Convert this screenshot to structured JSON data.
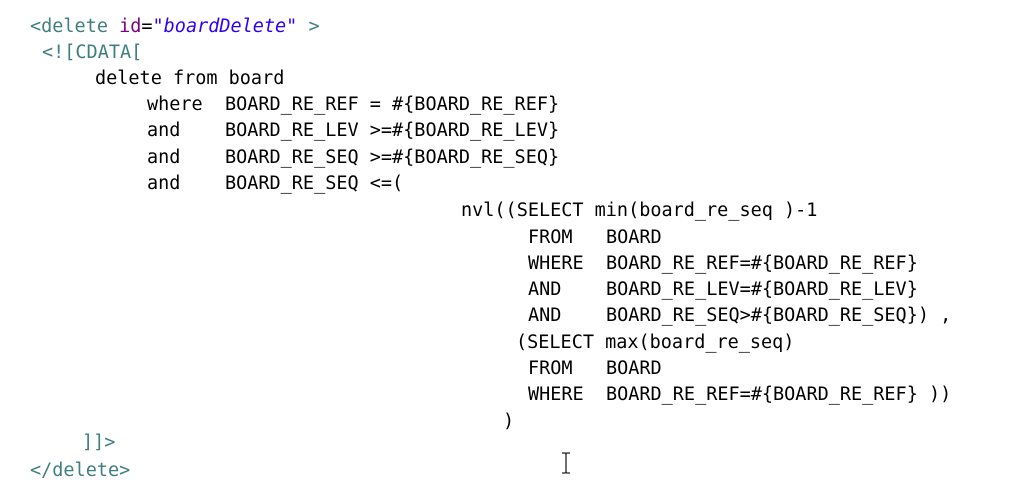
{
  "editor": {
    "colors": {
      "tag": "#3f7f7f",
      "attribute": "#7f007f",
      "string": "#2a00ff",
      "text": "#000000",
      "background": "#ffffff"
    },
    "lines": [
      {
        "indent": 0,
        "tokens": [
          {
            "t": "tag",
            "v": "<delete "
          },
          {
            "t": "attr",
            "v": "id"
          },
          {
            "t": "punct",
            "v": "="
          },
          {
            "t": "str",
            "v": "\"boardDelete\""
          },
          {
            "t": "tag",
            "v": " >"
          }
        ]
      },
      {
        "indent": 1,
        "tokens": [
          {
            "t": "cdata",
            "v": "<![CDATA["
          }
        ]
      },
      {
        "indent": 2,
        "tokens": [
          {
            "t": "kw",
            "v": "delete from board"
          }
        ]
      },
      {
        "indent": 3,
        "tokens": [
          {
            "t": "kw",
            "v": "where  BOARD_RE_REF = #{BOARD_RE_REF}"
          }
        ]
      },
      {
        "indent": 3,
        "tokens": [
          {
            "t": "kw",
            "v": "and    BOARD_RE_LEV >=#{BOARD_RE_LEV}"
          }
        ]
      },
      {
        "indent": 3,
        "tokens": [
          {
            "t": "kw",
            "v": "and    BOARD_RE_SEQ >=#{BOARD_RE_SEQ}"
          }
        ]
      },
      {
        "indent": 3,
        "tokens": [
          {
            "t": "kw",
            "v": "and    BOARD_RE_SEQ <=("
          }
        ]
      },
      {
        "indent": 4,
        "tokens": [
          {
            "t": "kw",
            "v": "nvl((SELECT min(board_re_seq )-1"
          }
        ]
      },
      {
        "indent": 5,
        "tokens": [
          {
            "t": "kw",
            "v": "FROM   BOARD"
          }
        ]
      },
      {
        "indent": 5,
        "tokens": [
          {
            "t": "kw",
            "v": "WHERE  BOARD_RE_REF=#{BOARD_RE_REF}"
          }
        ]
      },
      {
        "indent": 5,
        "tokens": [
          {
            "t": "kw",
            "v": "AND    BOARD_RE_LEV=#{BOARD_RE_LEV}"
          }
        ]
      },
      {
        "indent": 5,
        "tokens": [
          {
            "t": "kw",
            "v": "AND    BOARD_RE_SEQ>#{BOARD_RE_SEQ}) ,"
          }
        ]
      },
      {
        "indent": 6,
        "tokens": [
          {
            "t": "kw",
            "v": "(SELECT max(board_re_seq)"
          }
        ]
      },
      {
        "indent": 5,
        "tokens": [
          {
            "t": "kw",
            "v": "FROM   BOARD"
          }
        ]
      },
      {
        "indent": 5,
        "tokens": [
          {
            "t": "kw",
            "v": "WHERE  BOARD_RE_REF=#{BOARD_RE_REF} ))"
          }
        ]
      },
      {
        "indent": 7,
        "tokens": [
          {
            "t": "kw",
            "v": ")"
          }
        ]
      },
      {
        "indent": 8,
        "tokens": []
      },
      {
        "indent": 9,
        "tokens": [
          {
            "t": "cdata",
            "v": "]]>"
          }
        ]
      },
      {
        "indent": 0,
        "tokens": [
          {
            "t": "tag",
            "v": "</delete>"
          }
        ]
      }
    ]
  }
}
